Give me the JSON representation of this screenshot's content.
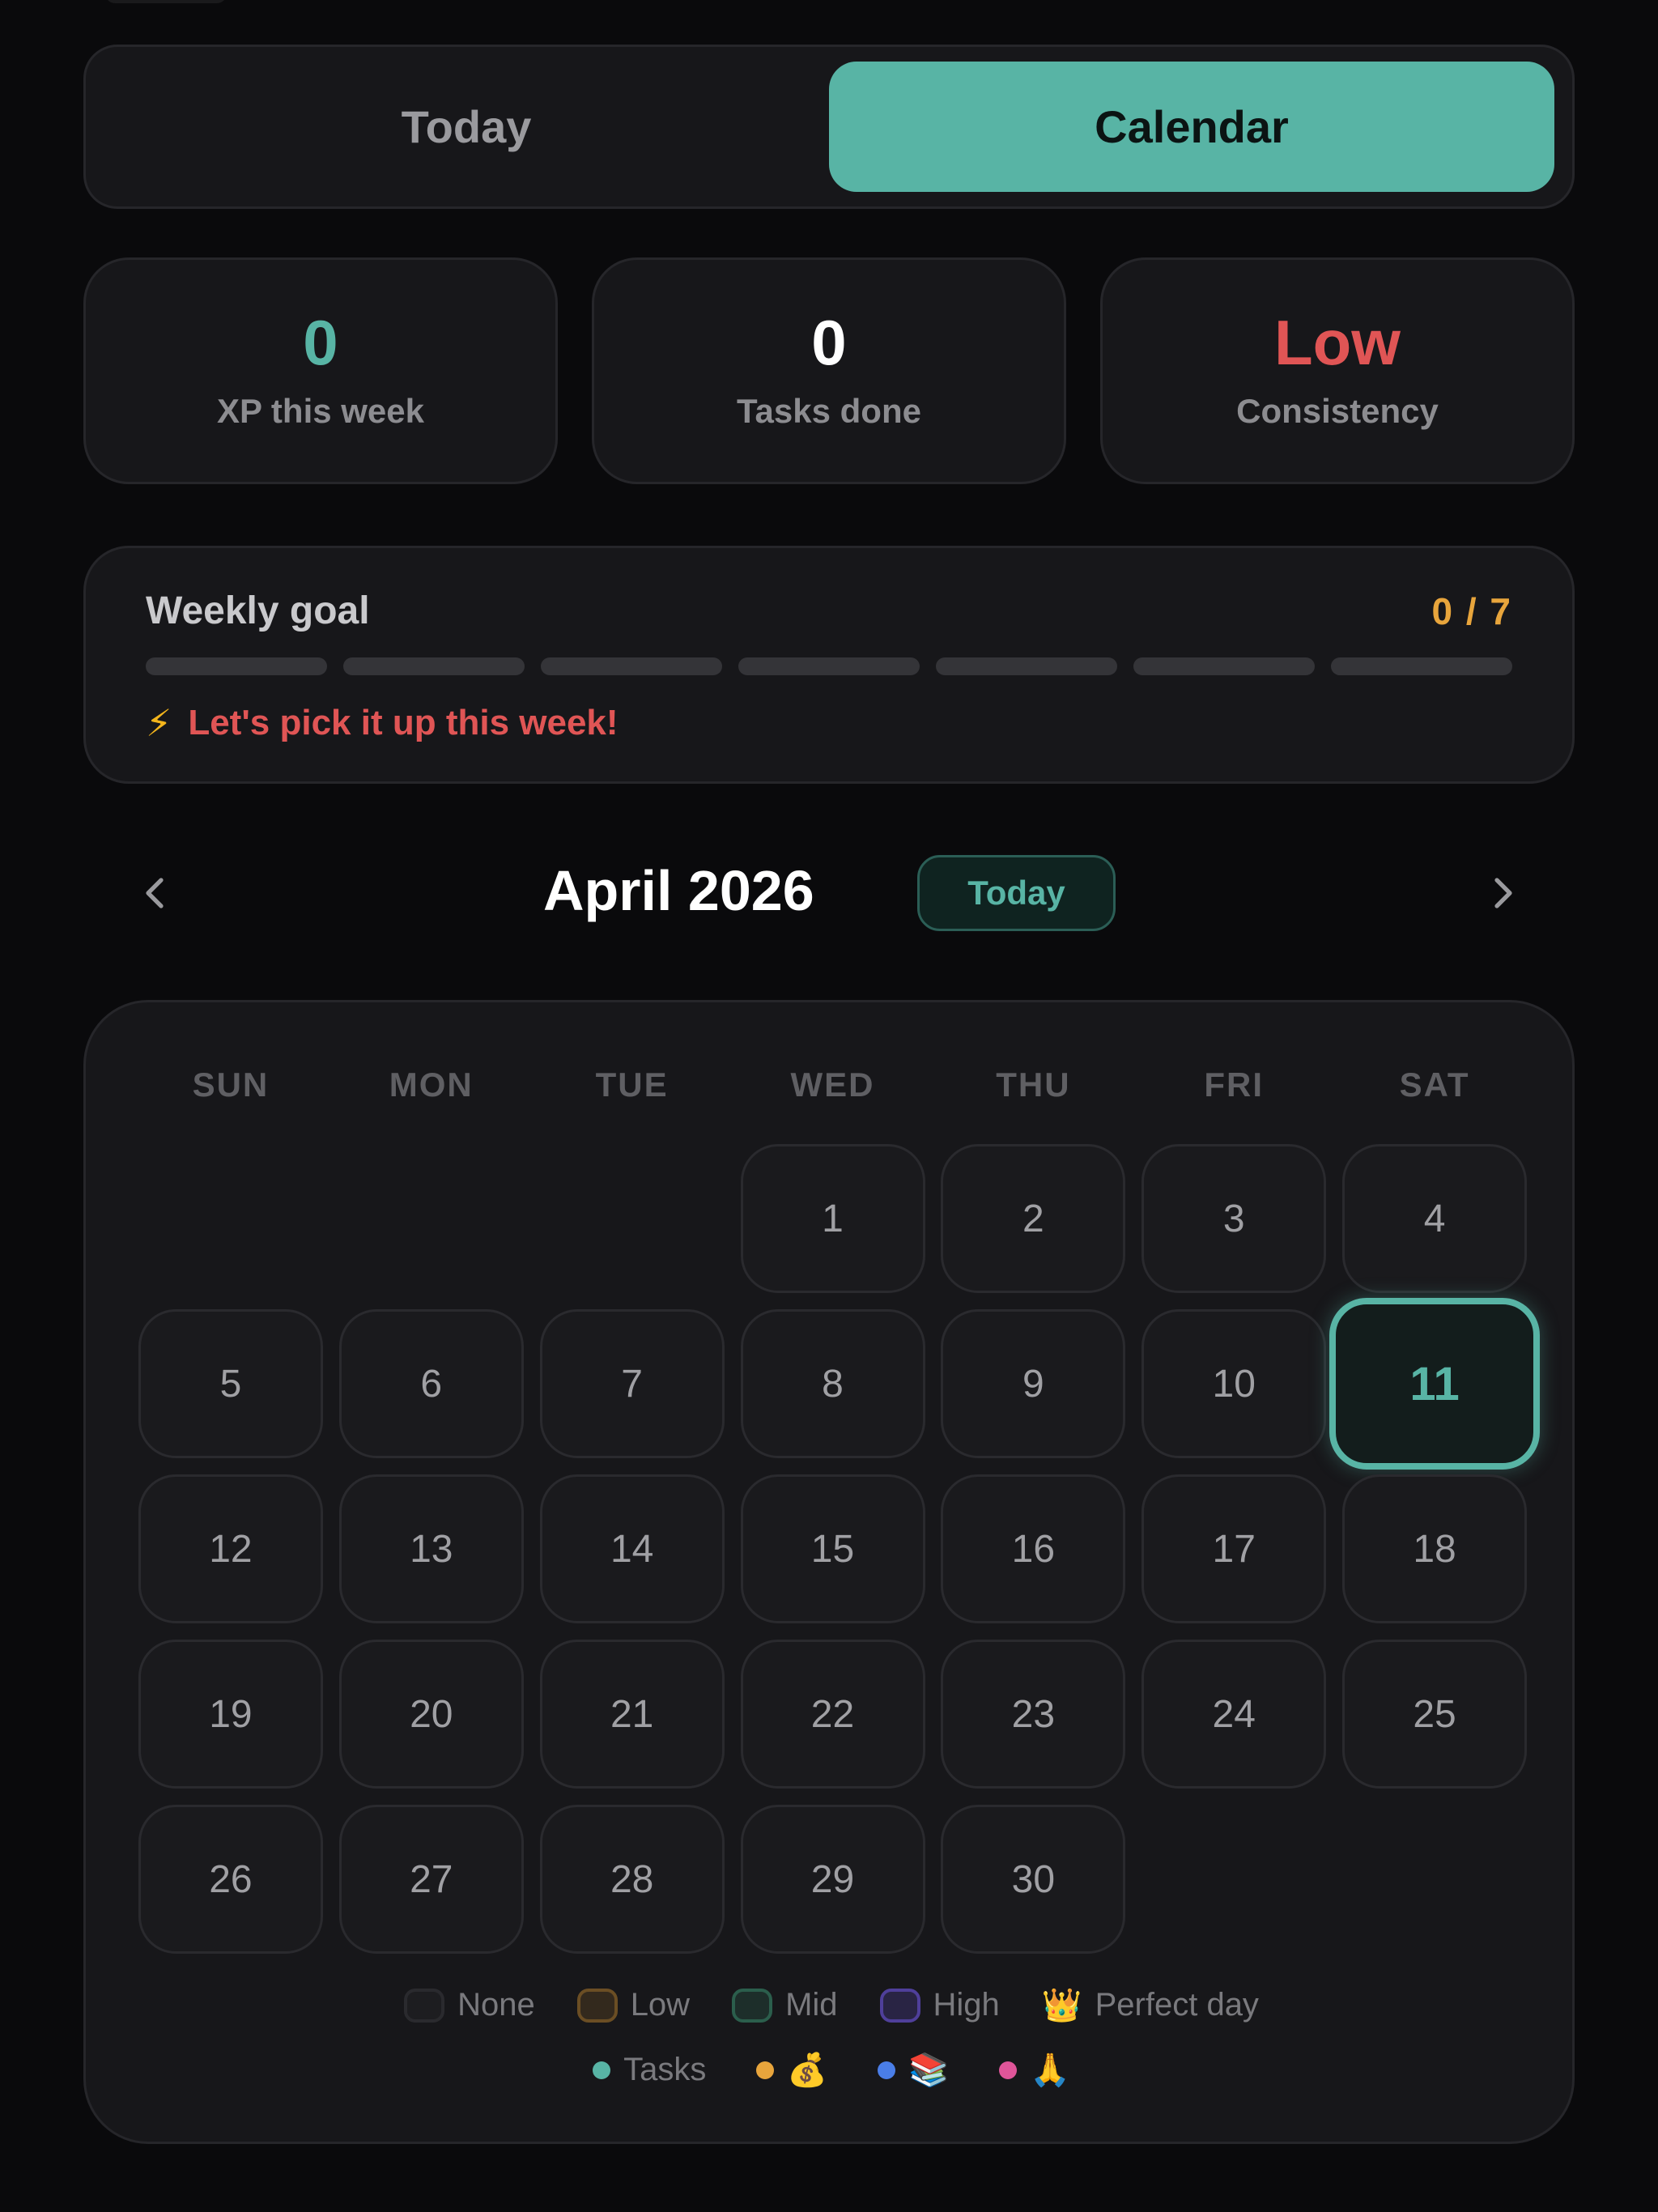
{
  "tabs": {
    "today": "Today",
    "calendar": "Calendar"
  },
  "stats": {
    "xp": {
      "value": "0",
      "label": "XP this week"
    },
    "tasks": {
      "value": "0",
      "label": "Tasks done"
    },
    "consistency": {
      "value": "Low",
      "label": "Consistency"
    }
  },
  "goal": {
    "title": "Weekly goal",
    "count": "0 / 7",
    "completed": 0,
    "total": 7,
    "message": "Let's pick it up this week!",
    "message_icon": "lightning-icon"
  },
  "month": {
    "title": "April 2026",
    "today_button": "Today"
  },
  "weekdays": [
    "SUN",
    "MON",
    "TUE",
    "WED",
    "THU",
    "FRI",
    "SAT"
  ],
  "calendar": {
    "first_weekday": 3,
    "days_in_month": 30,
    "today": 11
  },
  "legend": {
    "levels": [
      {
        "label": "None",
        "color": "#2a2a2e"
      },
      {
        "label": "Low",
        "color": "#6b4e24"
      },
      {
        "label": "Mid",
        "color": "#2b5e4c"
      },
      {
        "label": "High",
        "color": "#4f3f9a"
      },
      {
        "label": "Perfect day",
        "icon": "👑"
      }
    ],
    "categories": [
      {
        "label": "Tasks",
        "color": "#58b4a5"
      },
      {
        "icon": "💰",
        "color": "#e8a53c"
      },
      {
        "icon": "📚",
        "color": "#4a7ee8"
      },
      {
        "icon": "🙏",
        "color": "#e05599"
      }
    ]
  },
  "colors": {
    "accent": "#58b4a5",
    "warning": "#e05555",
    "goal": "#e8a53c",
    "bg": "#0a0a0c",
    "card": "#17171a"
  }
}
